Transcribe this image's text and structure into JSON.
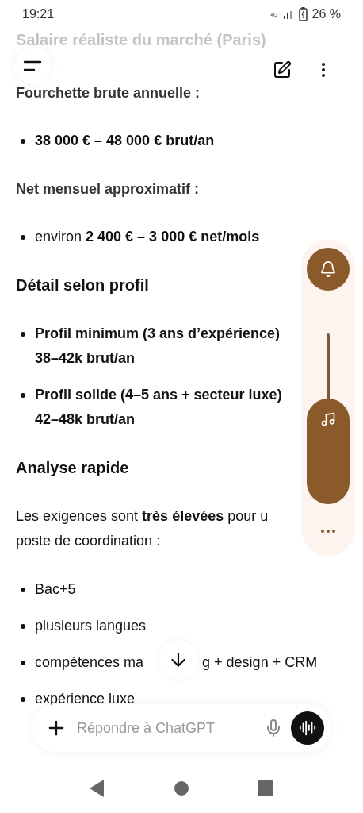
{
  "status_bar": {
    "time": "19:21",
    "network": "4G",
    "battery": "26 %"
  },
  "content": [
    {
      "kind": "faded-heading",
      "text": "Salaire réaliste du marché (Paris)"
    },
    {
      "kind": "label",
      "text": "Fourchette brute annuelle :"
    },
    {
      "kind": "bullet",
      "lines": [
        "**38 000 € – 48 000 € brut/an**"
      ]
    },
    {
      "kind": "label",
      "text": "Net mensuel approximatif :"
    },
    {
      "kind": "bullet",
      "lines": [
        "environ **2 400 € – 3 000 € net/mois**"
      ]
    },
    {
      "kind": "heading",
      "text": "Détail selon profil"
    },
    {
      "kind": "bullet",
      "lines": [
        "**Profil minimum (3 ans d’expérience)**",
        "**38–42k brut/an**"
      ]
    },
    {
      "kind": "bullet",
      "lines": [
        "**Profil solide (4–5 ans + secteur luxe)**",
        "**42–48k brut/an**"
      ]
    },
    {
      "kind": "heading",
      "text": "Analyse rapide"
    },
    {
      "kind": "paragraph",
      "lines": [
        "Les exigences sont **très élevées** pour u",
        "poste de coordination :"
      ]
    },
    {
      "kind": "bullet",
      "lines": [
        "Bac+5"
      ]
    },
    {
      "kind": "bullet",
      "lines": [
        "plusieurs langues"
      ]
    },
    {
      "kind": "gapped-bullet",
      "parts": [
        "compétences ma",
        "g + design + CRM"
      ]
    },
    {
      "kind": "bullet",
      "lines": [
        "expérience luxe"
      ]
    }
  ],
  "volume_panel": {
    "level": 0.62
  },
  "composer": {
    "placeholder": "Répondre à ChatGPT"
  }
}
